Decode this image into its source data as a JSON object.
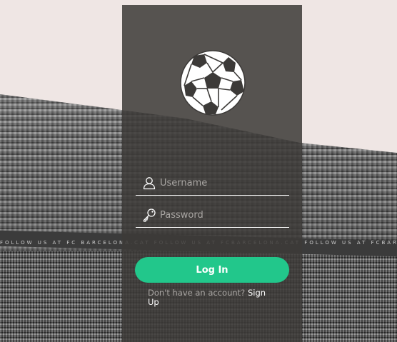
{
  "background": {
    "ad_text": "FOLLOW US AT  FC  BARCELONA.CAT  FOLLOW US AT  FCBARCELONA.CAT  FOLLOW US AT  FCBARCELONA.CAT"
  },
  "login": {
    "logo_icon": "soccer-ball-icon",
    "username": {
      "icon": "user-icon",
      "placeholder": "Username",
      "value": ""
    },
    "password": {
      "icon": "key-icon",
      "placeholder": "Password",
      "value": ""
    },
    "login_button_label": "Log In",
    "signup_prompt": "Don't have an account?",
    "signup_link": "Sign Up"
  },
  "colors": {
    "accent": "#22c78b",
    "card_background": "#3c3a38",
    "placeholder_text": "#a9a6a3",
    "text": "#ffffff"
  }
}
